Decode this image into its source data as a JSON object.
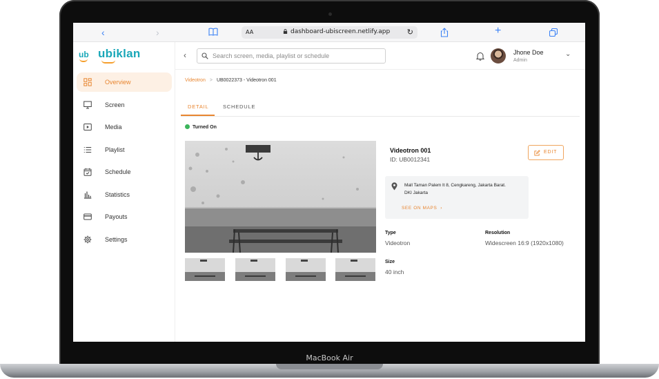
{
  "device_label": "MacBook Air",
  "browser": {
    "text_size_label": "AA",
    "url": "dashboard-ubiscreen.netlify.app"
  },
  "brand": {
    "mark": "ub",
    "name": "ubiklan",
    "primary_color": "#19a7b8",
    "accent_color": "#e8852f"
  },
  "sidebar": {
    "items": [
      {
        "label": "Overview",
        "icon": "grid-icon",
        "active": true
      },
      {
        "label": "Screen",
        "icon": "monitor-icon",
        "active": false
      },
      {
        "label": "Media",
        "icon": "play-icon",
        "active": false
      },
      {
        "label": "Playlist",
        "icon": "list-icon",
        "active": false
      },
      {
        "label": "Schedule",
        "icon": "calendar-icon",
        "active": false
      },
      {
        "label": "Statistics",
        "icon": "bar-chart-icon",
        "active": false
      },
      {
        "label": "Payouts",
        "icon": "card-icon",
        "active": false
      },
      {
        "label": "Settings",
        "icon": "gear-icon",
        "active": false
      }
    ]
  },
  "topbar": {
    "search_placeholder": "Search screen, media, playlist or schedule",
    "user_name": "Jhone Doe",
    "user_role": "Admin"
  },
  "breadcrumb": {
    "parent": "Videotron",
    "separator": ">",
    "current": "UB0022373 - Videotron 001"
  },
  "tabs": [
    {
      "label": "DETAIL",
      "active": true
    },
    {
      "label": "SCHEDULE",
      "active": false
    }
  ],
  "status": {
    "text": "Turned On",
    "color": "#3cb55c"
  },
  "device": {
    "name": "Videotron 001",
    "id_text": "ID: UB0012341",
    "edit_label": "EDIT",
    "address_line1": "Mall Taman Palem lt 8, Cengkareng, Jakarta Barat.",
    "address_line2": "DKI Jakarta",
    "maps_label": "SEE ON MAPS",
    "specs": {
      "type_label": "Type",
      "type_value": "Videotron",
      "resolution_label": "Resolution",
      "resolution_value": "Widescreen 16:9 (1920x1080)",
      "size_label": "Size",
      "size_value": "40 inch"
    }
  }
}
